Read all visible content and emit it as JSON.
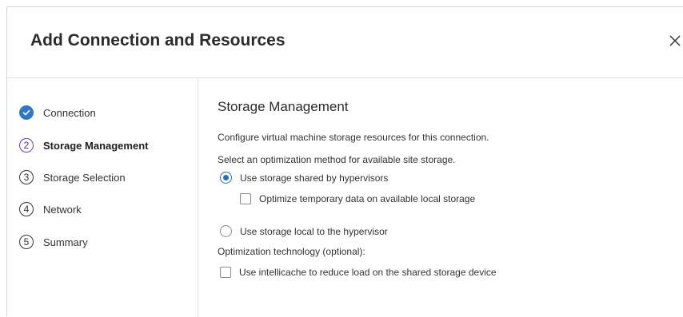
{
  "dialog": {
    "title": "Add Connection and Resources",
    "close_icon": "close-icon"
  },
  "steps": [
    {
      "number": "",
      "label": "Connection",
      "state": "done",
      "icon": "check-icon"
    },
    {
      "number": "2",
      "label": "Storage Management",
      "state": "active"
    },
    {
      "number": "3",
      "label": "Storage Selection",
      "state": "pending"
    },
    {
      "number": "4",
      "label": "Network",
      "state": "pending"
    },
    {
      "number": "5",
      "label": "Summary",
      "state": "pending"
    }
  ],
  "main": {
    "section_title": "Storage Management",
    "description": "Configure virtual machine storage resources for this connection.",
    "optimization_prompt": "Select an optimization method for available site storage.",
    "option_shared": {
      "label": "Use storage shared by hypervisors",
      "selected": true
    },
    "option_optimize_temp": {
      "label": "Optimize temporary data on available local storage",
      "checked": false
    },
    "option_local": {
      "label": "Use storage local to the hypervisor",
      "selected": false
    },
    "technology_label": "Optimization technology (optional):",
    "option_intellicache": {
      "label": "Use intellicache to reduce load on the shared storage device",
      "checked": false
    }
  },
  "colors": {
    "accent": "#2e78c7",
    "radio_selected": "#1f6fc2",
    "active_step": "#6a3fb5"
  }
}
